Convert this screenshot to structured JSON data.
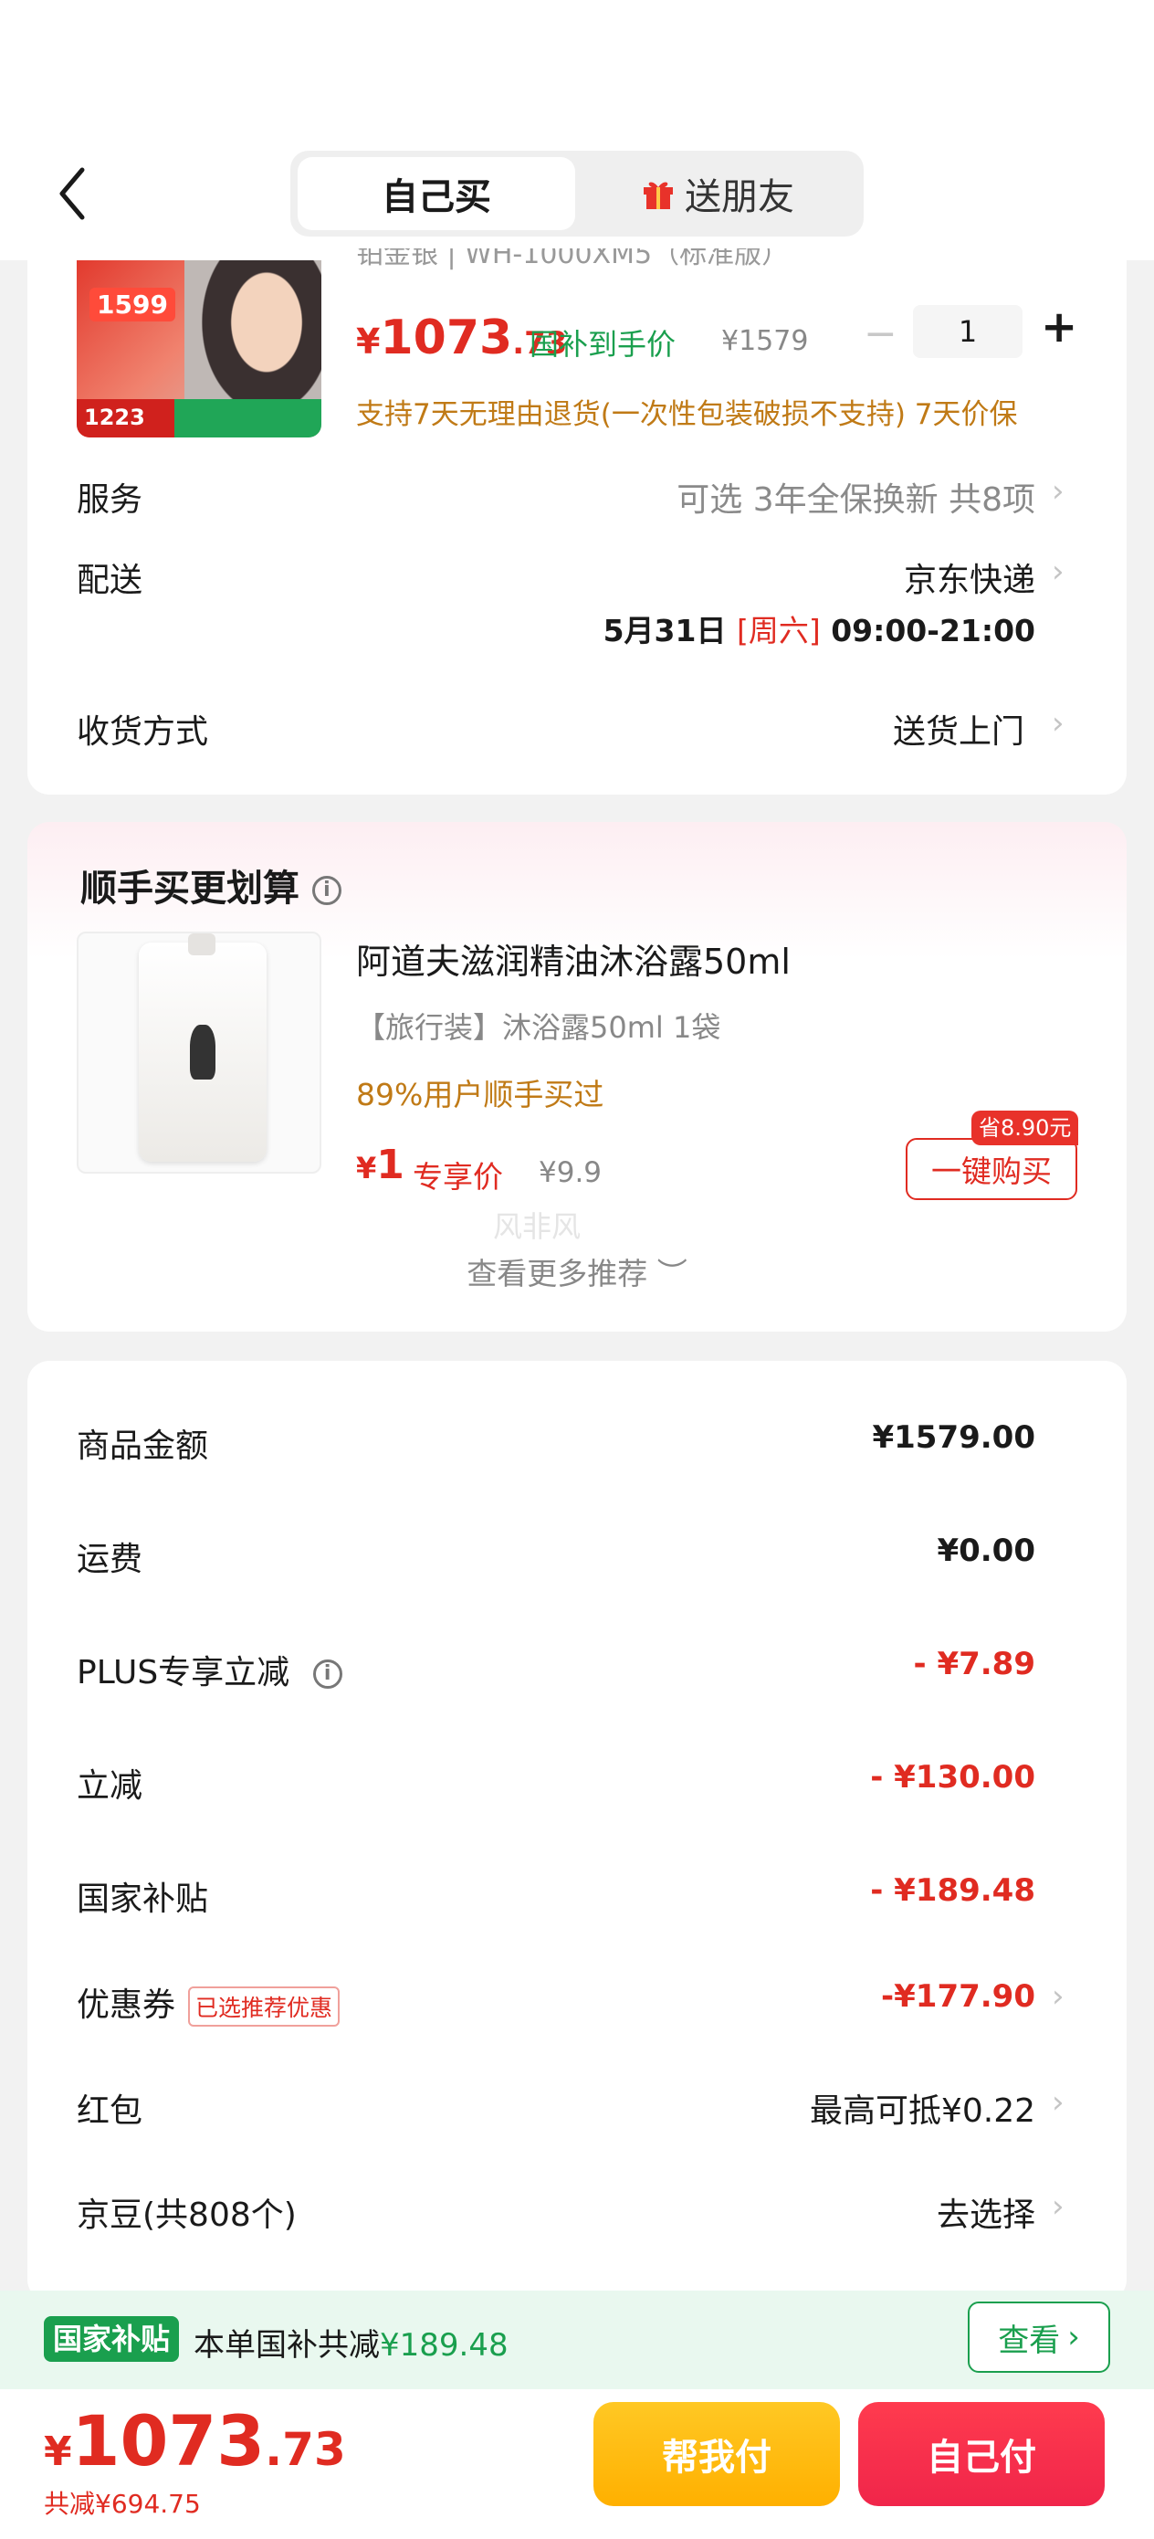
{
  "nav": {
    "tab_self": "自己买",
    "tab_friend": "送朋友"
  },
  "product": {
    "title_cut": "铂金银 | WH-1000XM5（标准版）",
    "thumb_price_top": "1599",
    "thumb_price_bottom": "1223",
    "price_yen": "¥",
    "price_int": "1073",
    "price_dec": ".73",
    "subsidy_label": "国补到手价",
    "original_price": "¥1579",
    "minus": "−",
    "quantity": "1",
    "plus": "+",
    "return_note": "支持7天无理由退货(一次性包装破损不支持) 7天价保"
  },
  "rows": {
    "service_label": "服务",
    "service_value": "可选 3年全保换新 共8项",
    "delivery_label": "配送",
    "delivery_value": "京东快递",
    "delivery_date": "5月31日",
    "delivery_weekday": "[周六]",
    "delivery_time": "09:00-21:00",
    "receive_label": "收货方式",
    "receive_value": "送货上门",
    "chevron": "›"
  },
  "recommend": {
    "title": "顺手买更划算",
    "info": "i",
    "name": "阿道夫滋润精油沐浴露50ml",
    "spec": "【旅行装】沐浴露50ml 1袋",
    "bought": "89%用户顺手买过",
    "price_yen": "¥",
    "price_int": "1",
    "exclusive": "专享价",
    "original_price": "¥9.9",
    "save_tag": "省8.90元",
    "buy_button": "一键购买",
    "watermark": "风非风",
    "see_more": "查看更多推荐 ︶"
  },
  "summary": {
    "goods_label": "商品金额",
    "goods_value": "¥1579.00",
    "shipping_label": "运费",
    "shipping_value": "¥0.00",
    "plus_label": "PLUS专享立减",
    "plus_value": "- ¥7.89",
    "discount_label": "立减",
    "discount_value": "- ¥130.00",
    "subsidy_label": "国家补贴",
    "subsidy_value": "- ¥189.48",
    "coupon_label": "优惠券",
    "coupon_tag": "已选推荐优惠",
    "coupon_value": "-¥177.90",
    "redpacket_label": "红包",
    "redpacket_value": "最高可抵¥0.22",
    "jingdou_label": "京豆(共808个)",
    "jingdou_value": "去选择"
  },
  "gb_bar": {
    "badge": "国家补贴",
    "text_prefix": "本单国补共减",
    "text_amount": "¥189.48",
    "view_button": "查看",
    "view_arrow": "›"
  },
  "checkout": {
    "total_yen": "¥",
    "total_int": "1073",
    "total_dec": ".73",
    "saved": "共减¥694.75",
    "help_pay": "帮我付",
    "self_pay": "自己付"
  },
  "colors": {
    "accent_red": "#e02b21",
    "subsidy_green": "#1a9f4e",
    "note_orange": "#c07a16",
    "help_pay_yellow": "#ffb000",
    "self_pay_red": "#f0254a"
  }
}
